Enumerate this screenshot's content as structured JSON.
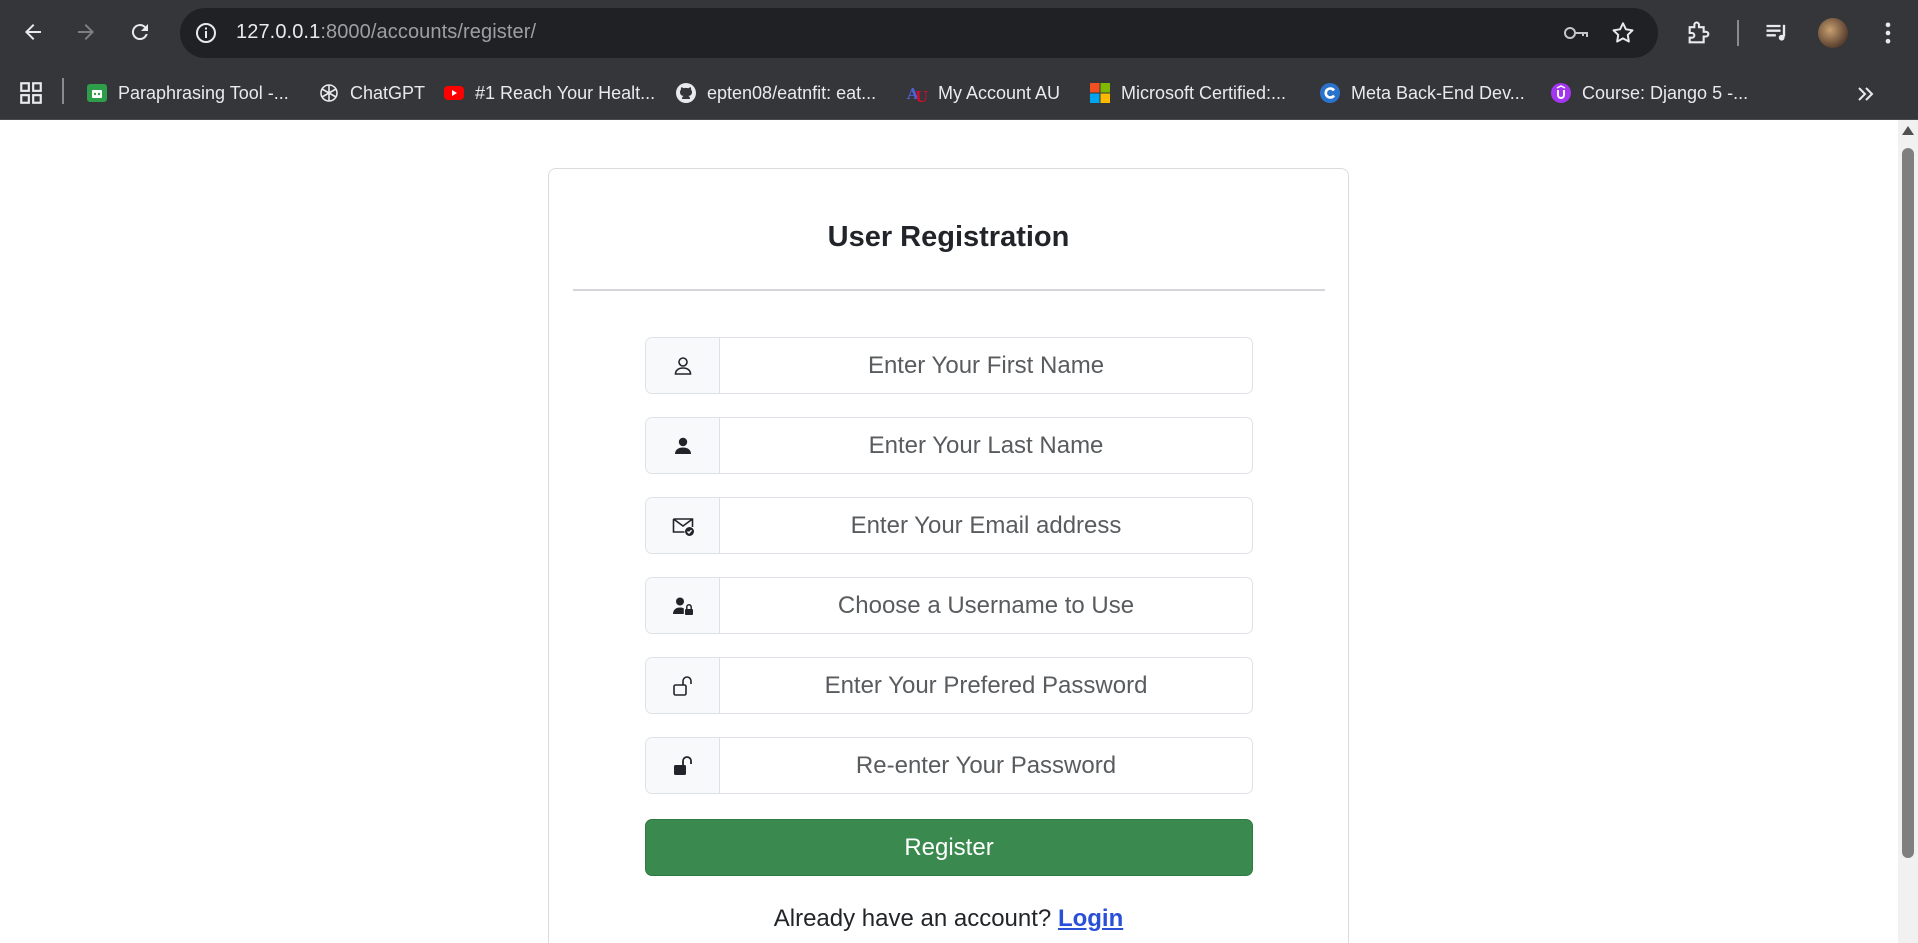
{
  "browser": {
    "url_host": "127.0.0.1",
    "url_rest": ":8000/accounts/register/",
    "bookmarks": [
      {
        "label": "Paraphrasing Tool -...",
        "icon": "paraphrase-favicon-icon",
        "color": "#2e9e4a"
      },
      {
        "label": "ChatGPT",
        "icon": "chatgpt-favicon-icon",
        "color": "#e8eaed"
      },
      {
        "label": "#1 Reach Your Healt...",
        "icon": "youtube-favicon-icon",
        "color": "#ff0000"
      },
      {
        "label": "epten08/eatnfit: eat...",
        "icon": "github-favicon-icon",
        "color": "#e8eaed"
      },
      {
        "label": "My Account AU",
        "icon": "au-favicon-icon",
        "color": "#c8102e"
      },
      {
        "label": "Microsoft Certified:...",
        "icon": "microsoft-favicon-icon",
        "color": "#f25022"
      },
      {
        "label": "Meta Back-End Dev...",
        "icon": "coursera-favicon-icon",
        "color": "#2a73cc"
      },
      {
        "label": "Course: Django 5 -...",
        "icon": "udemy-favicon-icon",
        "color": "#a435f0"
      }
    ]
  },
  "form": {
    "title": "User Registration",
    "fields": [
      {
        "placeholder": "Enter Your First Name",
        "icon": "person-outline-icon"
      },
      {
        "placeholder": "Enter Your Last Name",
        "icon": "person-fill-icon"
      },
      {
        "placeholder": "Enter Your Email address",
        "icon": "envelope-check-icon"
      },
      {
        "placeholder": "Choose a Username to Use",
        "icon": "person-lock-icon"
      },
      {
        "placeholder": "Enter Your Prefered Password",
        "icon": "unlock-outline-icon"
      },
      {
        "placeholder": "Re-enter Your Password",
        "icon": "unlock-fill-icon"
      }
    ],
    "submit_label": "Register",
    "login_prompt": "Already have an account?",
    "login_link": "Login"
  },
  "colors": {
    "register_button": "#3a8a4f",
    "login_link": "#2b50d8",
    "chrome_bg": "#35363a"
  }
}
